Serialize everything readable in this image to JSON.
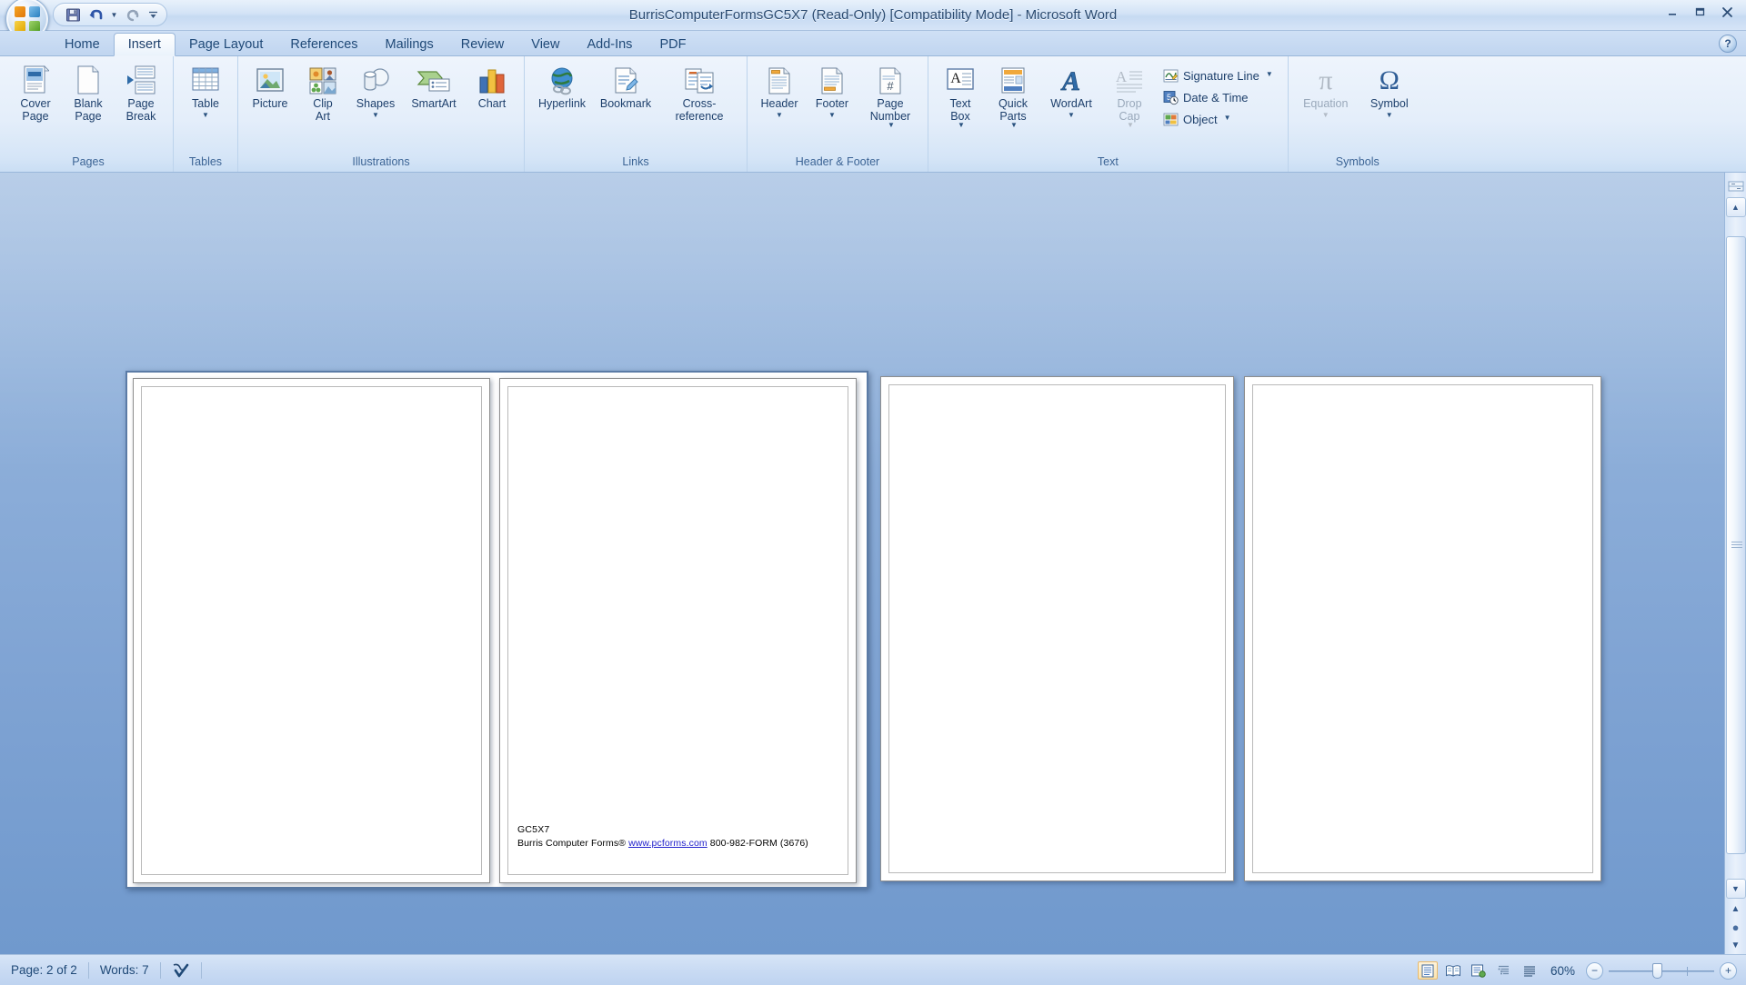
{
  "window": {
    "title": "BurrisComputerFormsGC5X7 (Read-Only) [Compatibility Mode] - Microsoft Word",
    "minimize_label": "—",
    "restore_label": "❐",
    "close_label": "✕",
    "help_label": "?"
  },
  "quick_access": {
    "items": [
      {
        "name": "save",
        "label": "Save",
        "icon": "save-icon"
      },
      {
        "name": "undo",
        "label": "Undo",
        "icon": "undo-icon"
      },
      {
        "name": "undo-dropdown",
        "label": "▾",
        "icon": "chevron-down-icon"
      },
      {
        "name": "redo",
        "label": "Redo",
        "icon": "redo-icon"
      },
      {
        "name": "customize",
        "label": "▾",
        "icon": "customize-qat-icon"
      }
    ]
  },
  "tabs": [
    {
      "label": "Home",
      "active": false
    },
    {
      "label": "Insert",
      "active": true
    },
    {
      "label": "Page Layout",
      "active": false
    },
    {
      "label": "References",
      "active": false
    },
    {
      "label": "Mailings",
      "active": false
    },
    {
      "label": "Review",
      "active": false
    },
    {
      "label": "View",
      "active": false
    },
    {
      "label": "Add-Ins",
      "active": false
    },
    {
      "label": "PDF",
      "active": false
    }
  ],
  "ribbon": {
    "groups": [
      {
        "label": "Pages",
        "buttons": [
          {
            "label": "Cover\nPage",
            "icon": "cover-page-icon",
            "dropdown": true,
            "disabled": false
          },
          {
            "label": "Blank\nPage",
            "icon": "blank-page-icon",
            "dropdown": false,
            "disabled": false
          },
          {
            "label": "Page\nBreak",
            "icon": "page-break-icon",
            "dropdown": false,
            "disabled": false
          }
        ]
      },
      {
        "label": "Tables",
        "buttons": [
          {
            "label": "Table",
            "icon": "table-icon",
            "dropdown": true,
            "dropdown_below": true,
            "disabled": false
          }
        ]
      },
      {
        "label": "Illustrations",
        "buttons": [
          {
            "label": "Picture",
            "icon": "picture-icon",
            "dropdown": false,
            "disabled": false
          },
          {
            "label": "Clip\nArt",
            "icon": "clip-art-icon",
            "dropdown": false,
            "disabled": false
          },
          {
            "label": "Shapes",
            "icon": "shapes-icon",
            "dropdown": true,
            "dropdown_below": true,
            "disabled": false
          },
          {
            "label": "SmartArt",
            "icon": "smartart-icon",
            "dropdown": false,
            "disabled": false
          },
          {
            "label": "Chart",
            "icon": "chart-icon",
            "dropdown": false,
            "disabled": false
          }
        ]
      },
      {
        "label": "Links",
        "buttons": [
          {
            "label": "Hyperlink",
            "icon": "hyperlink-icon",
            "dropdown": false,
            "disabled": false
          },
          {
            "label": "Bookmark",
            "icon": "bookmark-icon",
            "dropdown": false,
            "disabled": false
          },
          {
            "label": "Cross-reference",
            "icon": "cross-reference-icon",
            "dropdown": false,
            "disabled": false
          }
        ]
      },
      {
        "label": "Header & Footer",
        "buttons": [
          {
            "label": "Header",
            "icon": "header-icon",
            "dropdown": true,
            "dropdown_below": true,
            "disabled": false
          },
          {
            "label": "Footer",
            "icon": "footer-icon",
            "dropdown": true,
            "dropdown_below": true,
            "disabled": false
          },
          {
            "label": "Page\nNumber",
            "icon": "page-number-icon",
            "dropdown": true,
            "disabled": false
          }
        ]
      },
      {
        "label": "Text",
        "buttons": [
          {
            "label": "Text\nBox",
            "icon": "text-box-icon",
            "dropdown": true,
            "disabled": false
          },
          {
            "label": "Quick\nParts",
            "icon": "quick-parts-icon",
            "dropdown": true,
            "disabled": false
          },
          {
            "label": "WordArt",
            "icon": "wordart-icon",
            "dropdown": true,
            "dropdown_below": true,
            "disabled": false
          },
          {
            "label": "Drop\nCap",
            "icon": "drop-cap-icon",
            "dropdown": true,
            "disabled": true
          }
        ],
        "small_buttons": [
          {
            "label": "Signature Line",
            "icon": "signature-line-icon",
            "dropdown": true
          },
          {
            "label": "Date & Time",
            "icon": "date-time-icon",
            "dropdown": false
          },
          {
            "label": "Object",
            "icon": "object-icon",
            "dropdown": true
          }
        ]
      },
      {
        "label": "Symbols",
        "buttons": [
          {
            "label": "Equation",
            "icon": "equation-icon",
            "glyph": "π",
            "dropdown": true,
            "dropdown_below": true,
            "disabled": true
          },
          {
            "label": "Symbol",
            "icon": "symbol-icon",
            "glyph": "Ω",
            "dropdown": true,
            "dropdown_below": true,
            "disabled": false
          }
        ]
      }
    ]
  },
  "document": {
    "page2_text": {
      "line1": "GC5X7",
      "line2_pre": "Burris Computer Forms® ",
      "line2_link": "www.pcforms.com",
      "line2_post": " 800-982-FORM (3676)"
    }
  },
  "scrollbar": {
    "select_browse_object": "select-browse-object",
    "previous_page": "previous-page",
    "next_page": "next-page"
  },
  "statusbar": {
    "page": "Page: 2 of 2",
    "words": "Words: 7",
    "proofing_icon": "proofing-errors-icon",
    "zoom": "60%",
    "zoom_out": "−",
    "zoom_in": "+",
    "views": [
      {
        "name": "print-layout",
        "label": "Print Layout",
        "active": true
      },
      {
        "name": "full-screen-reading",
        "label": "Full Screen Reading",
        "active": false
      },
      {
        "name": "web-layout",
        "label": "Web Layout",
        "active": false
      },
      {
        "name": "outline",
        "label": "Outline",
        "active": false
      },
      {
        "name": "draft",
        "label": "Draft",
        "active": false
      }
    ]
  },
  "colors": {
    "accent": "#1f4977",
    "titlebar": "#d3e3f6",
    "ribbon": "#e4eefa",
    "doc_background": "#7fa3d3",
    "link": "#2222cc"
  }
}
